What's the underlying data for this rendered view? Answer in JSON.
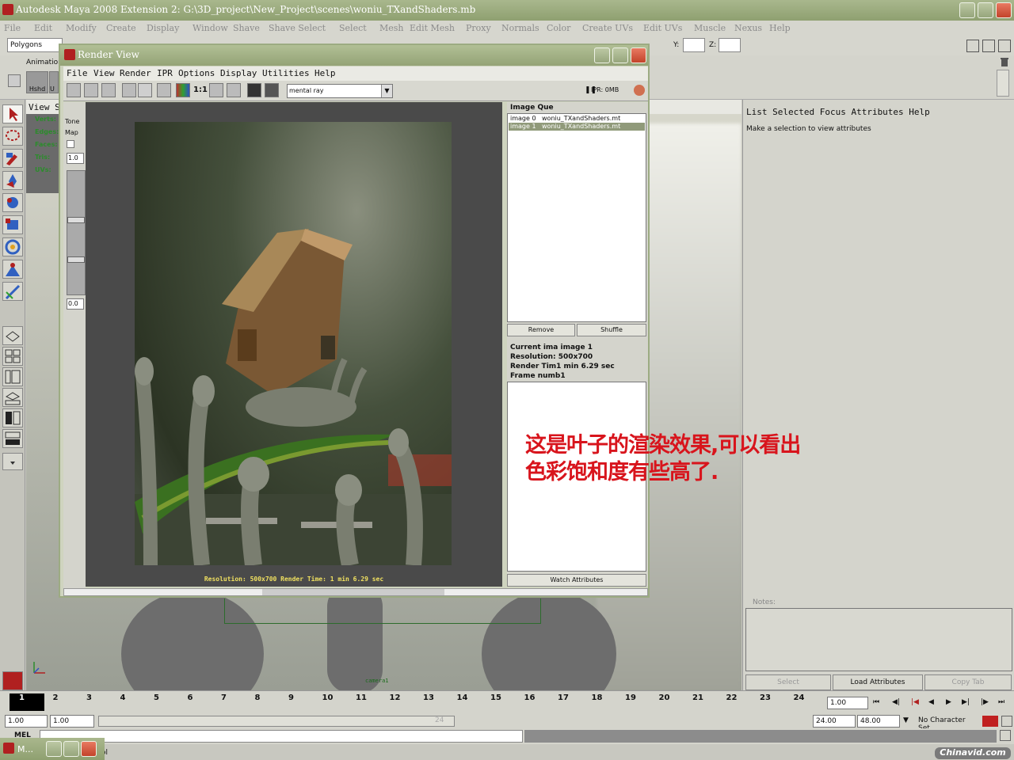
{
  "window": {
    "title": "Autodesk Maya 2008 Extension 2: G:\\3D_project\\New_Project\\scenes\\woniu_TXandShaders.mb"
  },
  "main_menu": [
    "File",
    "Edit",
    "Modify",
    "Create",
    "Display",
    "Window",
    "Shave",
    "Shave Select",
    "Select",
    "Mesh",
    "Edit Mesh",
    "Proxy",
    "Normals",
    "Color",
    "Create UVs",
    "Edit UVs",
    "Muscle",
    "Nexus",
    "Help"
  ],
  "status_line": {
    "mode": "Polygons",
    "y_label": "Y:",
    "z_label": "Z:"
  },
  "shelf": {
    "tab": "Animation",
    "buttons": [
      "Hshd",
      "U"
    ]
  },
  "viewport": {
    "panel_menu": "View S",
    "hud": [
      "Verts:",
      "Edges:",
      "Faces:",
      "Tris:",
      "UVs:"
    ],
    "camera_label": "camera1"
  },
  "attribute_editor": {
    "menu": "List Selected Focus Attributes Help",
    "hint": "Make a selection to view attributes",
    "notes_label": "Notes:",
    "buttons": {
      "select": "Select",
      "load": "Load Attributes",
      "copy": "Copy Tab"
    }
  },
  "render_view": {
    "title": "Render View",
    "menu": [
      "File",
      "View",
      "Render",
      "IPR",
      "Options",
      "Display",
      "Utilities",
      "Help"
    ],
    "ratio_label": "1:1",
    "renderer": "mental ray",
    "ipr_status": "IPR: 0MB",
    "tone_map": {
      "label1": "Tone",
      "label2": "Map",
      "top_value": "1.0",
      "bottom_value": "0.0"
    },
    "status_text": "Resolution:  500x700    Render Time:  1 min 6.29 sec",
    "image_queue": {
      "header": "Image Que",
      "items": [
        {
          "name": "image 0",
          "file": "woniu_TXandShaders.mt"
        },
        {
          "name": "image 1",
          "file": "woniu_TXandShaders.mt"
        }
      ],
      "remove": "Remove",
      "shuffle": "Shuffle"
    },
    "info": {
      "current": "Current ima image 1",
      "resolution": "Resolution: 500x700",
      "render_time": "Render Tim1 min 6.29 sec",
      "frame": "Frame numb1"
    },
    "watch": "Watch Attributes"
  },
  "annotation": {
    "line1": "这是叶子的渲染效果,可以看出",
    "line2": "色彩饱和度有些高了.",
    "color": "#d8141c"
  },
  "timeline": {
    "ticks": [
      "1",
      "2",
      "3",
      "4",
      "5",
      "6",
      "7",
      "8",
      "9",
      "10",
      "11",
      "12",
      "13",
      "14",
      "15",
      "16",
      "17",
      "18",
      "19",
      "20",
      "21",
      "22",
      "23",
      "24"
    ],
    "current_frame": "1.00"
  },
  "range": {
    "start": "1.00",
    "playback_start": "1.00",
    "slider_end": "24",
    "playback_end": "24.00",
    "end": "48.00",
    "character_set": "No Character Set"
  },
  "command_line": {
    "label": "MEL",
    "help_text": "ol"
  },
  "taskbar": {
    "label": "M..."
  },
  "watermark": "Chinavid.com"
}
